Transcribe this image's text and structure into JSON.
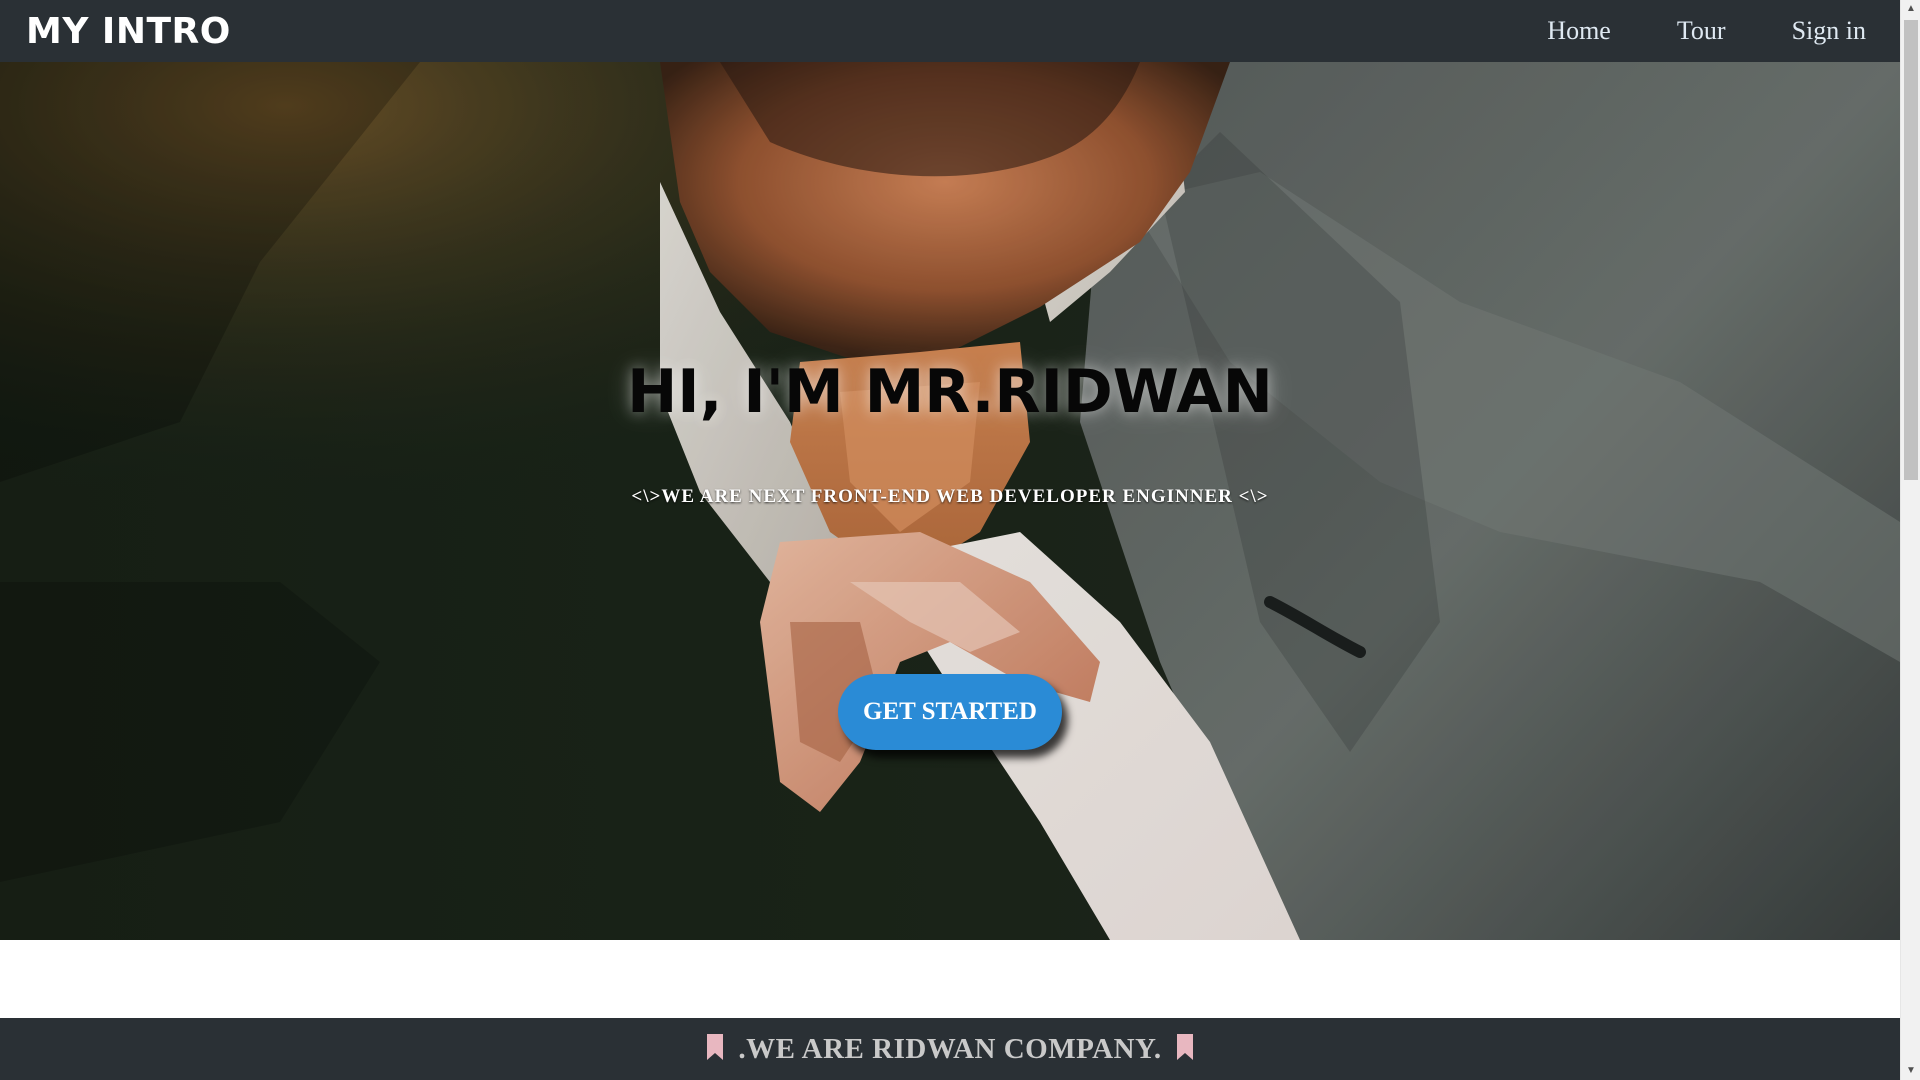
{
  "header": {
    "brand": "MY INTRO",
    "nav": [
      "Home",
      "Tour",
      "Sign in"
    ]
  },
  "hero": {
    "title": "HI, I'M MR.RIDWAN",
    "subtitle": "<\\>WE ARE NEXT FRONT-END WEB DEVELOPER ENGINNER <\\>",
    "cta_label": "GET STARTED",
    "cta_color": "#2a8bd6",
    "image_icon": "man-adjusting-tie-photo"
  },
  "footer": {
    "text": ".WE ARE RIDWAN COMPANY.",
    "icon": "bookmark-icon",
    "icon_color": "#e8b7c0"
  },
  "theme": {
    "nav_bg": "#2a3035",
    "nav_text": "#dfe9f2"
  }
}
